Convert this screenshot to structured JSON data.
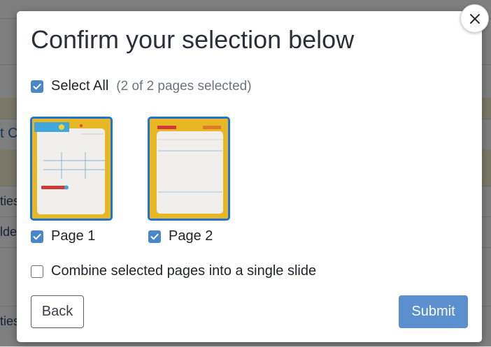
{
  "background": {
    "rows": [
      {
        "text": ""
      },
      {
        "text": ""
      },
      {
        "text": ""
      },
      {
        "text": "t C"
      },
      {
        "text": ""
      },
      {
        "text": "ties"
      },
      {
        "text": "lde"
      },
      {
        "text": ""
      },
      {
        "text": "ties"
      }
    ]
  },
  "modal": {
    "title": "Confirm your selection below",
    "close_icon": "close-icon",
    "select_all": {
      "label": "Select All",
      "count_text": "(2 of 2 pages selected)",
      "checked": true
    },
    "pages": [
      {
        "label": "Page 1",
        "checked": true
      },
      {
        "label": "Page 2",
        "checked": true
      }
    ],
    "combine": {
      "label": "Combine selected pages into a single slide",
      "checked": false
    },
    "back_label": "Back",
    "submit_label": "Submit"
  },
  "colors": {
    "accent": "#4a86c8",
    "thumb_border": "#1f73d6",
    "submit_bg": "#5b8fce",
    "thumb_frame": "#e8b824"
  }
}
